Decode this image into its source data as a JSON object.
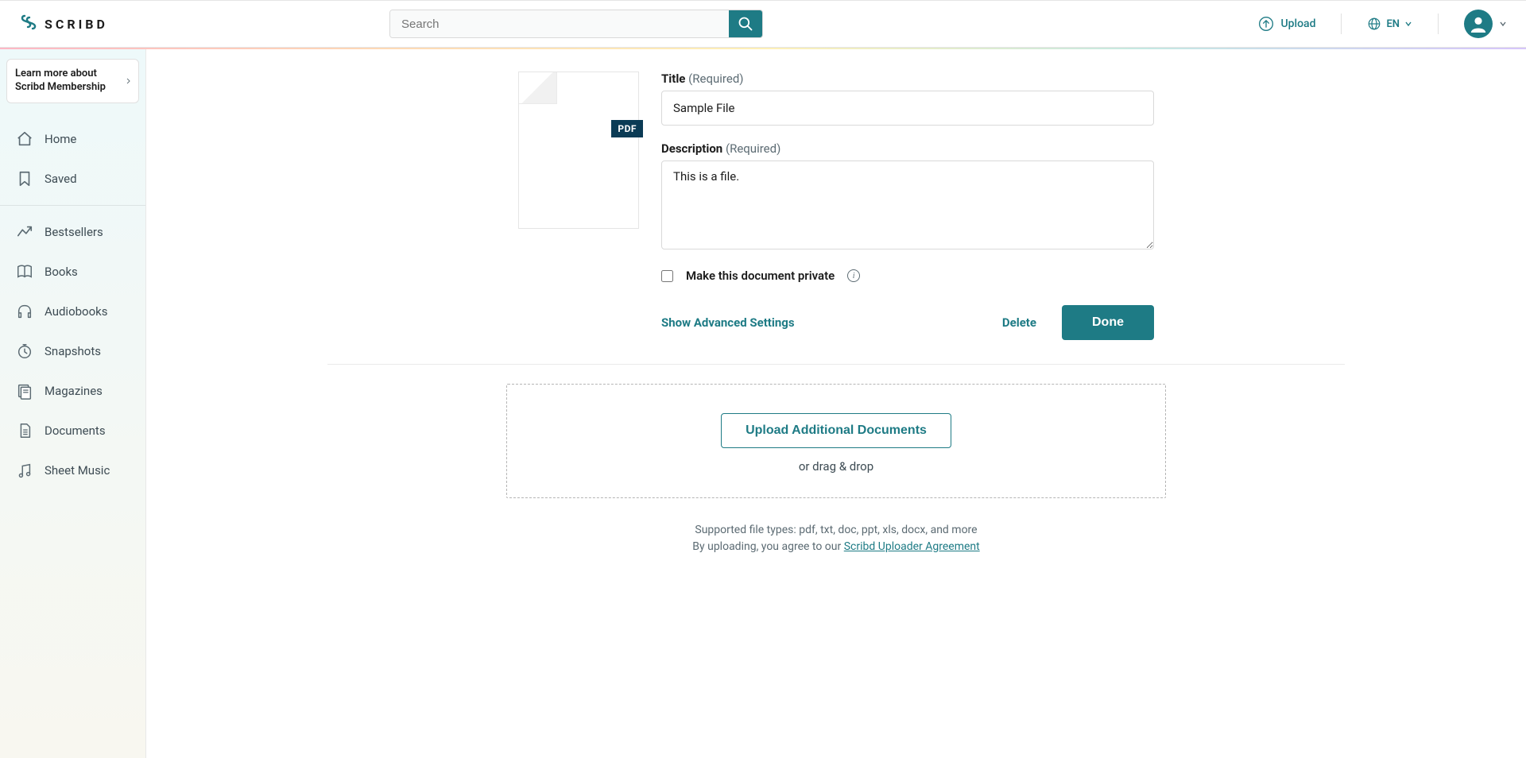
{
  "header": {
    "brand_text": "SCRIBD",
    "search_placeholder": "Search",
    "upload_label": "Upload",
    "lang_label": "EN"
  },
  "sidebar": {
    "membership_text": "Learn more about Scribd Membership",
    "group1": [
      {
        "key": "home",
        "label": "Home"
      },
      {
        "key": "saved",
        "label": "Saved"
      }
    ],
    "group2": [
      {
        "key": "bestsellers",
        "label": "Bestsellers"
      },
      {
        "key": "books",
        "label": "Books"
      },
      {
        "key": "audiobooks",
        "label": "Audiobooks"
      },
      {
        "key": "snapshots",
        "label": "Snapshots"
      },
      {
        "key": "magazines",
        "label": "Magazines"
      },
      {
        "key": "documents",
        "label": "Documents"
      },
      {
        "key": "sheetmusic",
        "label": "Sheet Music"
      }
    ]
  },
  "form": {
    "file_badge": "PDF",
    "title_label": "Title",
    "required_suffix": "(Required)",
    "title_value": "Sample File",
    "desc_label": "Description",
    "desc_value": "This is a file.",
    "private_label": "Make this document private",
    "advanced_label": "Show Advanced Settings",
    "delete_label": "Delete",
    "done_label": "Done"
  },
  "dropzone": {
    "button_label": "Upload Additional Documents",
    "drag_label": "or drag & drop",
    "supported_text": "Supported file types: pdf, txt, doc, ppt, xls, docx, and more",
    "agree_text": "By uploading, you agree to our ",
    "agreement_link": "Scribd Uploader Agreement"
  }
}
